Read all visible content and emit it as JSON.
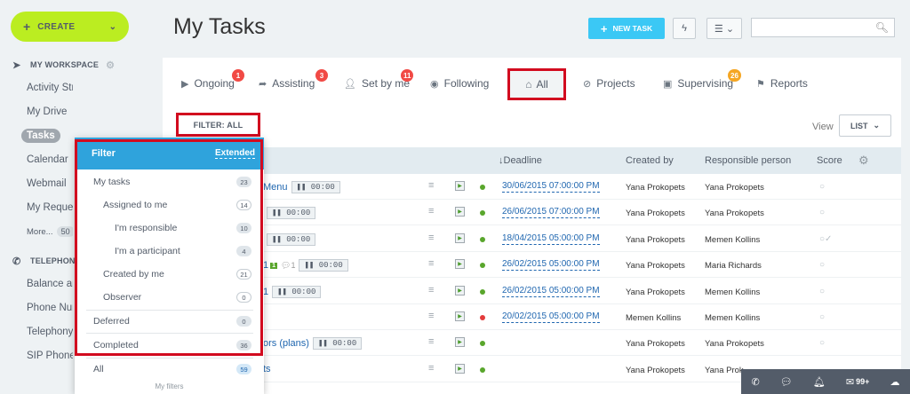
{
  "create": {
    "label": "CREATE"
  },
  "sidebar": {
    "workspace_title": "MY WORKSPACE",
    "items": [
      {
        "label": "Activity Stream"
      },
      {
        "label": "My Drive"
      },
      {
        "label": "Tasks"
      },
      {
        "label": "Calendar"
      },
      {
        "label": "Webmail"
      },
      {
        "label": "My Reques"
      }
    ],
    "more_label": "More...",
    "more_count": "50",
    "telephony_title": "TELEPHONY",
    "tel_items": [
      {
        "label": "Balance an"
      },
      {
        "label": "Phone Nur"
      },
      {
        "label": "Telephony"
      },
      {
        "label": "SIP Phones"
      }
    ]
  },
  "header": {
    "title": "My Tasks",
    "new_task": "NEW TASK",
    "search_placeholder": ""
  },
  "tabs": {
    "ongoing": {
      "label": "Ongoing",
      "badge": "1"
    },
    "assisting": {
      "label": "Assisting",
      "badge": "3"
    },
    "set_by_me": {
      "label": "Set by me",
      "badge": "11"
    },
    "following": {
      "label": "Following"
    },
    "all": {
      "label": "All"
    },
    "projects": {
      "label": "Projects"
    },
    "supervising": {
      "label": "Supervising",
      "badge": "26"
    },
    "reports": {
      "label": "Reports"
    }
  },
  "filter_button": {
    "label": "FILTER: ALL"
  },
  "view": {
    "label": "View",
    "list": "LIST"
  },
  "table": {
    "headers": {
      "deadline": "Deadline",
      "created_by": "Created by",
      "responsible": "Responsible person",
      "score": "Score"
    },
    "rows": [
      {
        "title": "Menu",
        "timer": "00:00",
        "deadline": "30/06/2015 07:00:00 PM",
        "created_by": "Yana Prokopets",
        "responsible": "Yana Prokopets",
        "status_color": "#59a62c",
        "score": "○"
      },
      {
        "title": "",
        "timer": "00:00",
        "deadline": "26/06/2015 07:00:00 PM",
        "created_by": "Yana Prokopets",
        "responsible": "Yana Prokopets",
        "status_color": "#59a62c",
        "score": "○"
      },
      {
        "title": "",
        "timer": "00:00",
        "deadline": "18/04/2015 05:00:00 PM",
        "created_by": "Yana Prokopets",
        "responsible": "Memen Kollins",
        "status_color": "#59a62c",
        "score": "○✓"
      },
      {
        "title": "1",
        "extra": "1",
        "comments": "1",
        "timer": "00:00",
        "deadline": "26/02/2015 05:00:00 PM",
        "created_by": "Yana Prokopets",
        "responsible": "Maria Richards",
        "status_color": "#59a62c",
        "score": "○"
      },
      {
        "title": "1",
        "timer": "00:00",
        "deadline": "26/02/2015 05:00:00 PM",
        "created_by": "Yana Prokopets",
        "responsible": "Memen Kollins",
        "status_color": "#59a62c",
        "score": "○"
      },
      {
        "title": "",
        "deadline": "20/02/2015 05:00:00 PM",
        "created_by": "Memen Kollins",
        "responsible": "Memen Kollins",
        "status_color": "#e33b3b",
        "score": "○"
      },
      {
        "title": "ors (plans)",
        "timer": "00:00",
        "deadline": "",
        "created_by": "Yana Prokopets",
        "responsible": "Yana Prokopets",
        "status_color": "#59a62c",
        "score": "○"
      },
      {
        "title": "ts",
        "deadline": "",
        "created_by": "Yana Prokopets",
        "responsible": "Yana Prok",
        "status_color": "#59a62c",
        "score": ""
      }
    ]
  },
  "filter_popup": {
    "title": "Filter",
    "extended": "Extended",
    "items": [
      {
        "label": "My tasks",
        "count": "23"
      },
      {
        "label": "Assigned to me",
        "count": "14"
      },
      {
        "label": "I'm responsible",
        "count": "10"
      },
      {
        "label": "I'm a participant",
        "count": "4"
      },
      {
        "label": "Created by me",
        "count": "21"
      },
      {
        "label": "Observer",
        "count": "0"
      },
      {
        "label": "Deferred",
        "count": "0"
      },
      {
        "label": "Completed",
        "count": "36"
      },
      {
        "label": "All",
        "count": "59"
      }
    ],
    "my_filters": "My filters"
  },
  "bottom_bar": {
    "count": "99+"
  }
}
